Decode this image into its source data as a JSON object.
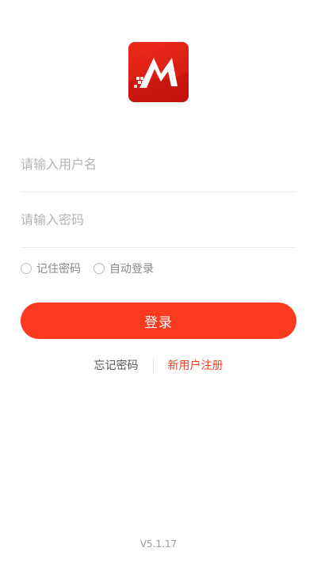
{
  "app": {
    "logo_icon": "brand-m-logo",
    "brand_color": "#fb3a1f"
  },
  "login_form": {
    "username_placeholder": "请输入用户名",
    "password_placeholder": "请输入密码",
    "remember_password_label": "记住密码",
    "auto_login_label": "自动登录",
    "remember_password_checked": false,
    "auto_login_checked": false,
    "login_button_label": "登录"
  },
  "links": {
    "forgot_password": "忘记密码",
    "register": "新用户注册",
    "register_color": "#f0402a"
  },
  "footer": {
    "version": "V5.1.17"
  }
}
